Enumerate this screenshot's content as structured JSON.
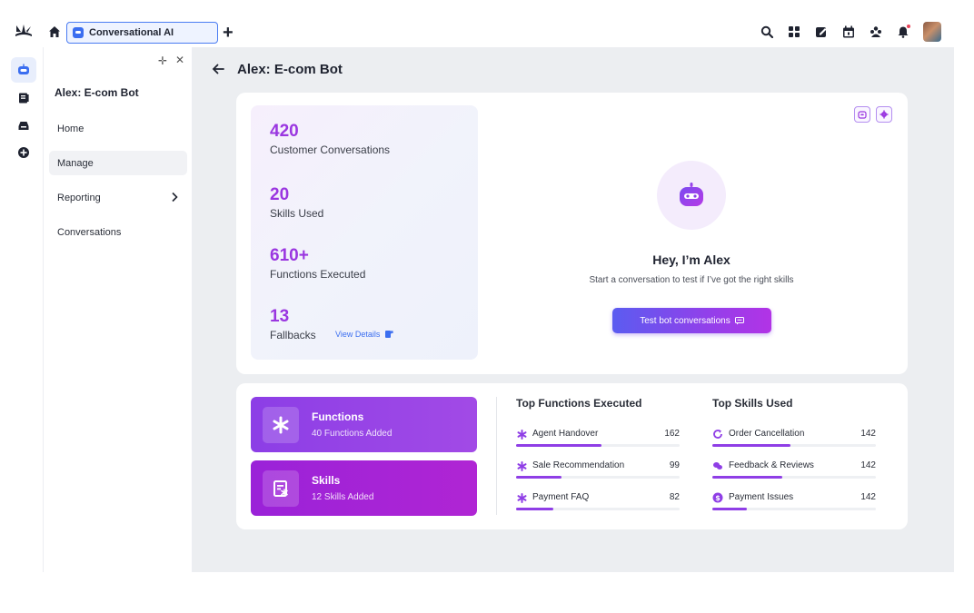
{
  "app": {
    "tab_label": "Conversational AI"
  },
  "sidenav": {
    "title": "Alex: E-com Bot",
    "items": [
      {
        "label": "Home"
      },
      {
        "label": "Manage"
      },
      {
        "label": "Reporting"
      },
      {
        "label": "Conversations"
      }
    ]
  },
  "page": {
    "title": "Alex: E-com Bot"
  },
  "stats": [
    {
      "value": "420",
      "label": "Customer Conversations"
    },
    {
      "value": "20",
      "label": "Skills Used"
    },
    {
      "value": "610+",
      "label": "Functions Executed"
    },
    {
      "value": "13",
      "label": "Fallbacks"
    }
  ],
  "view_details_label": "View Details",
  "bot_intro": {
    "greeting": "Hey, I’m Alex",
    "subtitle": "Start a conversation to test if I’ve got the right skills",
    "button_label": "Test bot conversations"
  },
  "features": {
    "functions": {
      "title": "Functions",
      "subtitle": "40 Functions Added"
    },
    "skills": {
      "title": "Skills",
      "subtitle": "12 Skills Added"
    }
  },
  "top_functions": {
    "title": "Top Functions Executed",
    "items": [
      {
        "name": "Agent Handover",
        "value": "162",
        "fill": 0.52
      },
      {
        "name": "Sale Recommendation",
        "value": "99",
        "fill": 0.28
      },
      {
        "name": "Payment FAQ",
        "value": "82",
        "fill": 0.23
      }
    ]
  },
  "top_skills": {
    "title": "Top Skills Used",
    "items": [
      {
        "name": "Order Cancellation",
        "value": "142",
        "fill": 0.48,
        "icon": "refresh-icon"
      },
      {
        "name": "Feedback & Reviews",
        "value": "142",
        "fill": 0.43,
        "icon": "chat-icon"
      },
      {
        "name": "Payment Issues",
        "value": "142",
        "fill": 0.21,
        "icon": "dollar-icon"
      }
    ]
  },
  "colors": {
    "accent": "#9a36e0",
    "link": "#3b6ef0",
    "bar_fill": "#8f3ee6"
  }
}
